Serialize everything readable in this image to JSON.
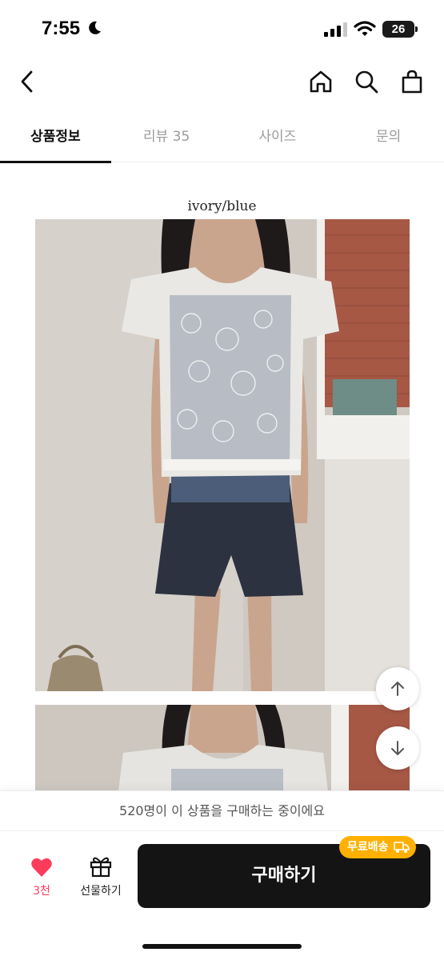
{
  "status": {
    "time": "7:55",
    "battery": "26"
  },
  "nav": {
    "icons": [
      "back-icon",
      "home-icon",
      "search-icon",
      "shopping-bag-icon"
    ]
  },
  "tabs": [
    {
      "label": "상품정보",
      "active": true
    },
    {
      "label": "리뷰 35",
      "active": false
    },
    {
      "label": "사이즈",
      "active": false
    },
    {
      "label": "문의",
      "active": false
    }
  ],
  "content": {
    "caption": "ivory/blue"
  },
  "notice": {
    "text": "520명이 이 상품을 구매하는 중이에요"
  },
  "bottom": {
    "like_count": "3천",
    "gift_label": "선물하기",
    "buy_label": "구매하기",
    "free_shipping_badge": "무료배송"
  },
  "colors": {
    "like": "#ff3b5c",
    "buy_button": "#141414",
    "badge": "#ffb000"
  }
}
